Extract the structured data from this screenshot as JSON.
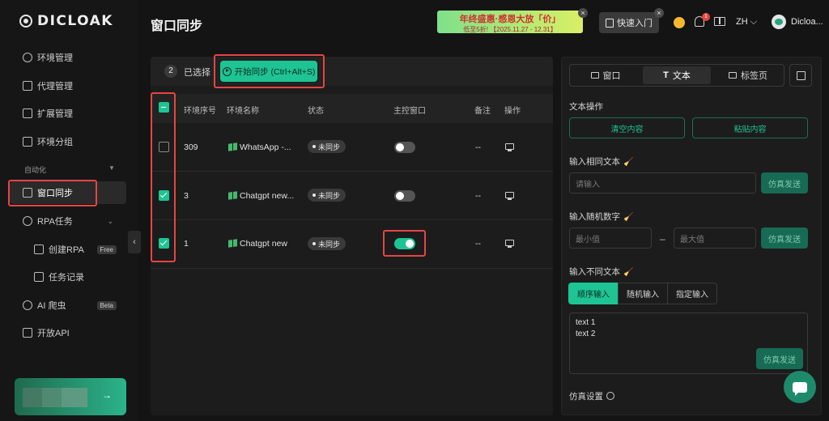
{
  "app": {
    "logo_text": "DICLOAK",
    "page_title": "窗口同步"
  },
  "sidebar": {
    "items": [
      {
        "label": "环境管理",
        "icon": "globe-icon"
      },
      {
        "label": "代理管理",
        "icon": "proxy-icon"
      },
      {
        "label": "扩展管理",
        "icon": "puzzle-icon"
      },
      {
        "label": "环境分组",
        "icon": "group-icon"
      }
    ],
    "section_label": "自动化",
    "automation_items": [
      {
        "label": "窗口同步",
        "icon": "sync-window-icon"
      },
      {
        "label": "RPA任务",
        "icon": "robot-icon"
      },
      {
        "label": "创建RPA",
        "icon": "store-icon",
        "tag": "Free"
      },
      {
        "label": "任务记录",
        "icon": "file-icon"
      },
      {
        "label": "AI 爬虫",
        "icon": "spider-icon",
        "tag": "Beta"
      },
      {
        "label": "开放API",
        "icon": "api-icon"
      }
    ],
    "promo_arrow": "→"
  },
  "header": {
    "banner_line1": "年终盛惠·感恩大放「价」",
    "banner_line2": "低至5折!  【2025.11.27 - 12.31】",
    "quick_start": "快速入门",
    "lang": "ZH",
    "username": "Dicloa..."
  },
  "toolbar": {
    "selected_count": "2",
    "selected_label": "已选择",
    "start_sync": "开始同步 (Ctrl+Alt+S)"
  },
  "table": {
    "headers": [
      "环境序号",
      "环境名称",
      "状态",
      "主控窗口",
      "备注",
      "操作"
    ],
    "rows": [
      {
        "checked": false,
        "seq": "309",
        "name": "WhatsApp -...",
        "status": "未同步",
        "master": false,
        "note": "--"
      },
      {
        "checked": true,
        "seq": "3",
        "name": "Chatgpt new...",
        "status": "未同步",
        "master": false,
        "note": "--"
      },
      {
        "checked": true,
        "seq": "1",
        "name": "Chatgpt new",
        "status": "未同步",
        "master": true,
        "note": "--"
      }
    ]
  },
  "panel": {
    "tabs": [
      "窗口",
      "文本",
      "标签页"
    ],
    "active_tab": "文本",
    "text_ops_label": "文本操作",
    "clear_content": "清空内容",
    "paste_content": "粘贴内容",
    "same_text_label": "输入相同文本",
    "same_text_placeholder": "请输入",
    "simulate_send": "仿真发送",
    "random_number_label": "输入随机数字",
    "min_placeholder": "最小值",
    "max_placeholder": "最大值",
    "range_dash": "–",
    "diff_text_label": "输入不同文本",
    "modes": [
      "顺序输入",
      "随机输入",
      "指定输入"
    ],
    "active_mode": "顺序输入",
    "texts": [
      "text 1",
      "text 2"
    ],
    "sim_settings_label": "仿真设置"
  },
  "colors": {
    "accent": "#1ec494",
    "highlight_box": "#e54545",
    "background": "#141414"
  }
}
